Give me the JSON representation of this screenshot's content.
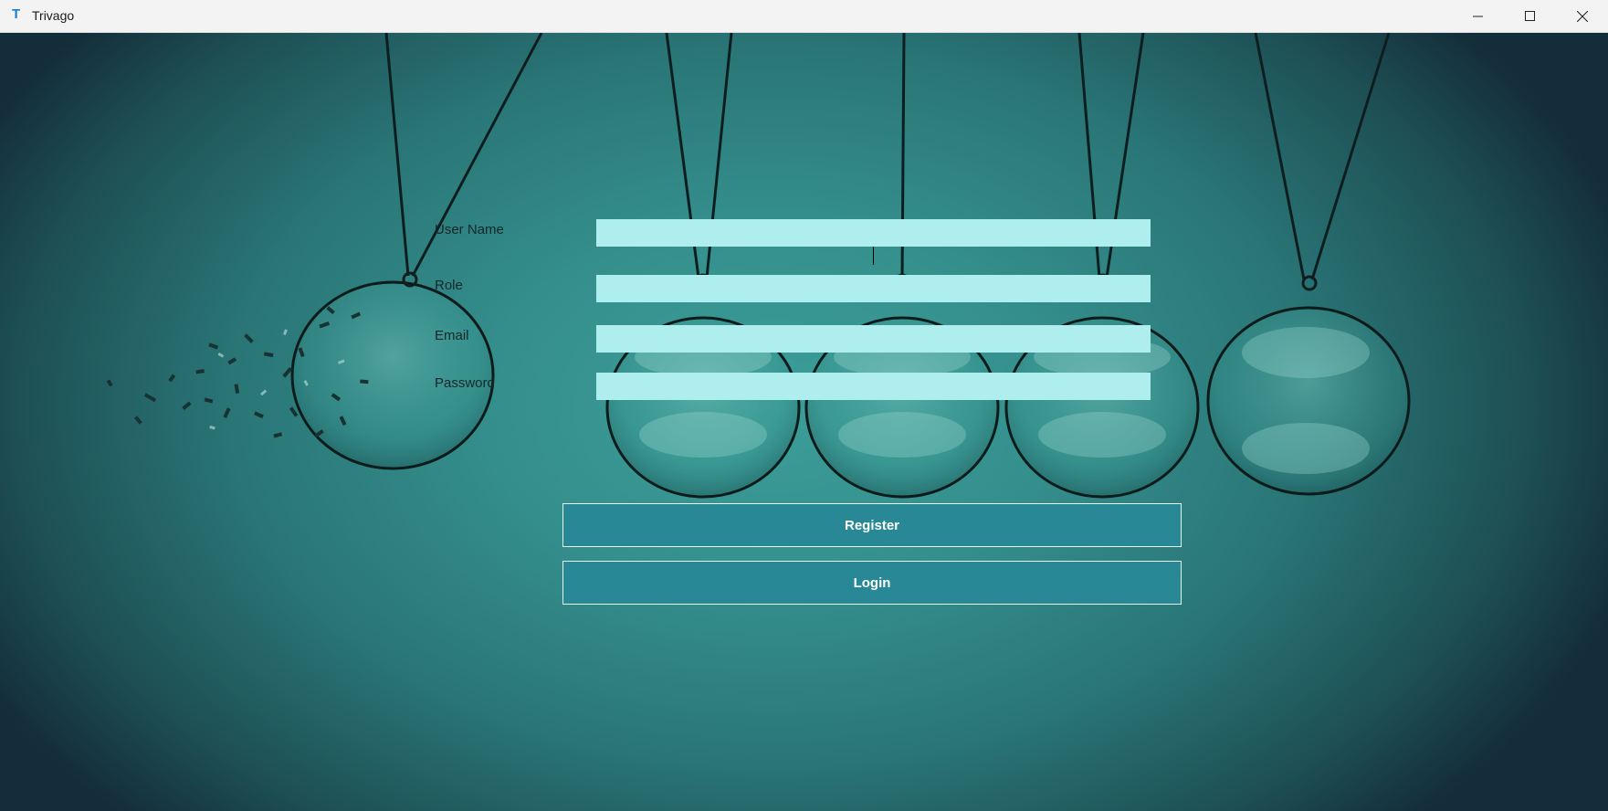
{
  "window": {
    "title": "Trivago",
    "icon_letter": "T",
    "icon_color": "#1b7fd4",
    "controls": [
      "minimize-icon",
      "maximize-icon",
      "close-icon"
    ]
  },
  "form": {
    "username_label": "User Name",
    "username_value": "",
    "role_label": "Role",
    "role_value": "",
    "email_label": "Email",
    "email_value": "",
    "password_label": "Password",
    "password_value": ""
  },
  "actions": {
    "register_label": "Register",
    "login_label": "Login"
  },
  "colors": {
    "field_background": "#afeeee",
    "button_background": "#288896",
    "button_border": "#e9f4f5",
    "background_teal": "#3c9d98"
  }
}
